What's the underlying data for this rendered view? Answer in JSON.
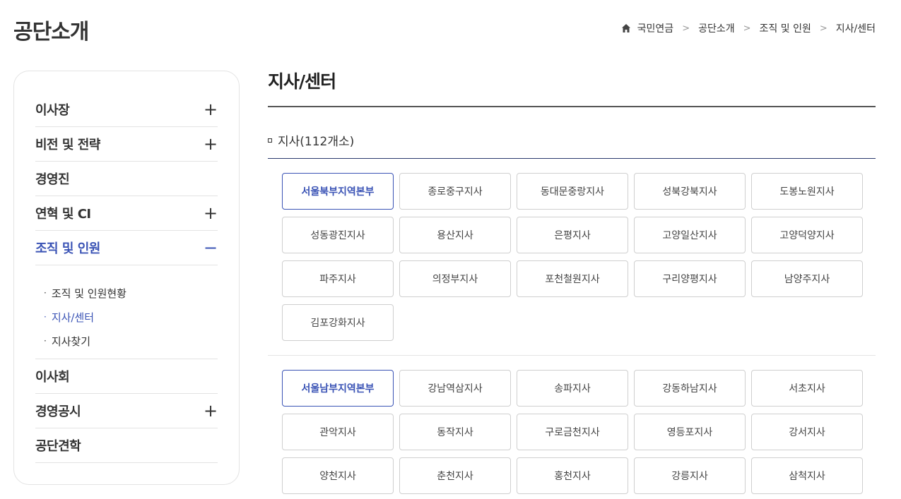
{
  "page": {
    "title": "공단소개"
  },
  "breadcrumb": {
    "items": [
      "국민연금",
      "공단소개",
      "조직 및 인원",
      "지사/센터"
    ]
  },
  "sidebar": {
    "items": [
      {
        "label": "이사장",
        "toggle": "+"
      },
      {
        "label": "비전 및 전략",
        "toggle": "+"
      },
      {
        "label": "경영진",
        "toggle": ""
      },
      {
        "label": "연혁 및 CI",
        "toggle": "+"
      },
      {
        "label": "조직 및 인원",
        "toggle": "−"
      },
      {
        "label": "이사회",
        "toggle": ""
      },
      {
        "label": "경영공시",
        "toggle": "+"
      },
      {
        "label": "공단견학",
        "toggle": ""
      }
    ],
    "sub_items": [
      {
        "label": "조직 및 인원현황"
      },
      {
        "label": "지사/센터"
      },
      {
        "label": "지사찾기"
      }
    ]
  },
  "content": {
    "title": "지사/센터",
    "section_heading": "지사(112개소)",
    "group1": [
      "서울북부지역본부",
      "종로중구지사",
      "동대문중랑지사",
      "성북강북지사",
      "도봉노원지사",
      "성동광진지사",
      "용산지사",
      "은평지사",
      "고양일산지사",
      "고양덕양지사",
      "파주지사",
      "의정부지사",
      "포천철원지사",
      "구리양평지사",
      "남양주지사",
      "김포강화지사"
    ],
    "group2": [
      "서울남부지역본부",
      "강남역삼지사",
      "송파지사",
      "강동하남지사",
      "서초지사",
      "관악지사",
      "동작지사",
      "구로금천지사",
      "영등포지사",
      "강서지사",
      "양천지사",
      "춘천지사",
      "홍천지사",
      "강릉지사",
      "삼척지사"
    ]
  },
  "colors": {
    "accent": "#3a53b5",
    "border": "#cfcfcf",
    "rule_dark": "#2b3a6e"
  },
  "icons": {
    "home": "home-icon",
    "breadcrumb_sep": "chevron-right-icon",
    "expand": "plus-icon",
    "collapse": "minus-icon"
  }
}
